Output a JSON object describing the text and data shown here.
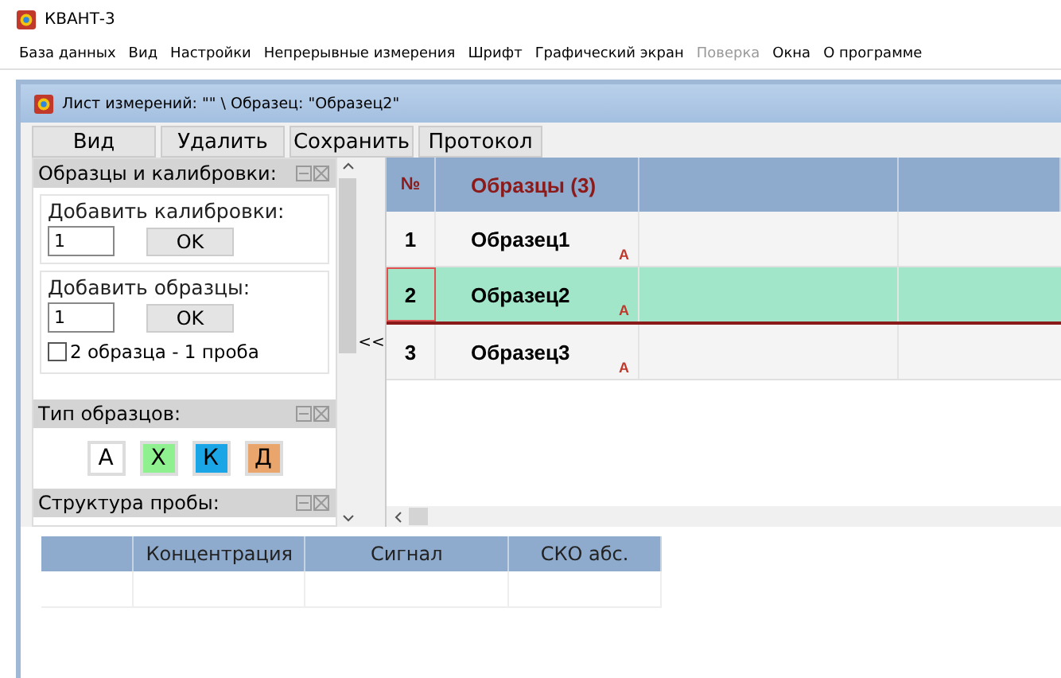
{
  "window": {
    "title": "КВАНТ-3"
  },
  "menu": [
    {
      "label": "База данных",
      "disabled": false
    },
    {
      "label": "Вид",
      "disabled": false
    },
    {
      "label": "Настройки",
      "disabled": false
    },
    {
      "label": "Непрерывные измерения",
      "disabled": false
    },
    {
      "label": "Шрифт",
      "disabled": false
    },
    {
      "label": "Графический экран",
      "disabled": false
    },
    {
      "label": "Поверка",
      "disabled": true
    },
    {
      "label": "Окна",
      "disabled": false
    },
    {
      "label": "О программе",
      "disabled": false
    }
  ],
  "child_window": {
    "title": "Лист измерений: \"\"  \\  Образец: \"Образец2\""
  },
  "toolbar": [
    "Вид",
    "Удалить",
    "Сохранить",
    "Протокол"
  ],
  "panels": {
    "samples": {
      "title": "Образцы и калибровки:",
      "add_calibrations": {
        "label": "Добавить калибровки:",
        "value": "1",
        "button": "OK"
      },
      "add_samples": {
        "label": "Добавить образцы:",
        "value": "1",
        "button": "OK",
        "option": {
          "label": "2 образца - 1 проба",
          "checked": false
        }
      }
    },
    "types": {
      "title": "Тип образцов:",
      "tags": [
        {
          "label": "А",
          "color": "#ffffff"
        },
        {
          "label": "Х",
          "color": "#8ef08e"
        },
        {
          "label": "К",
          "color": "#1aa5e6"
        },
        {
          "label": "Д",
          "color": "#e9a56b"
        }
      ]
    },
    "structure": {
      "title": "Структура пробы:"
    }
  },
  "collapse": "<<",
  "samples_table": {
    "columns": [
      "№",
      "Образцы (3)"
    ],
    "rows": [
      {
        "number": "1",
        "name": "Образец1",
        "type": "А",
        "selected": false
      },
      {
        "number": "2",
        "name": "Образец2",
        "type": "А",
        "selected": true
      },
      {
        "number": "3",
        "name": "Образец3",
        "type": "А",
        "selected": false
      }
    ]
  },
  "results_table": {
    "columns": [
      "Концентрация",
      "Сигнал",
      "СКО абс."
    ]
  }
}
